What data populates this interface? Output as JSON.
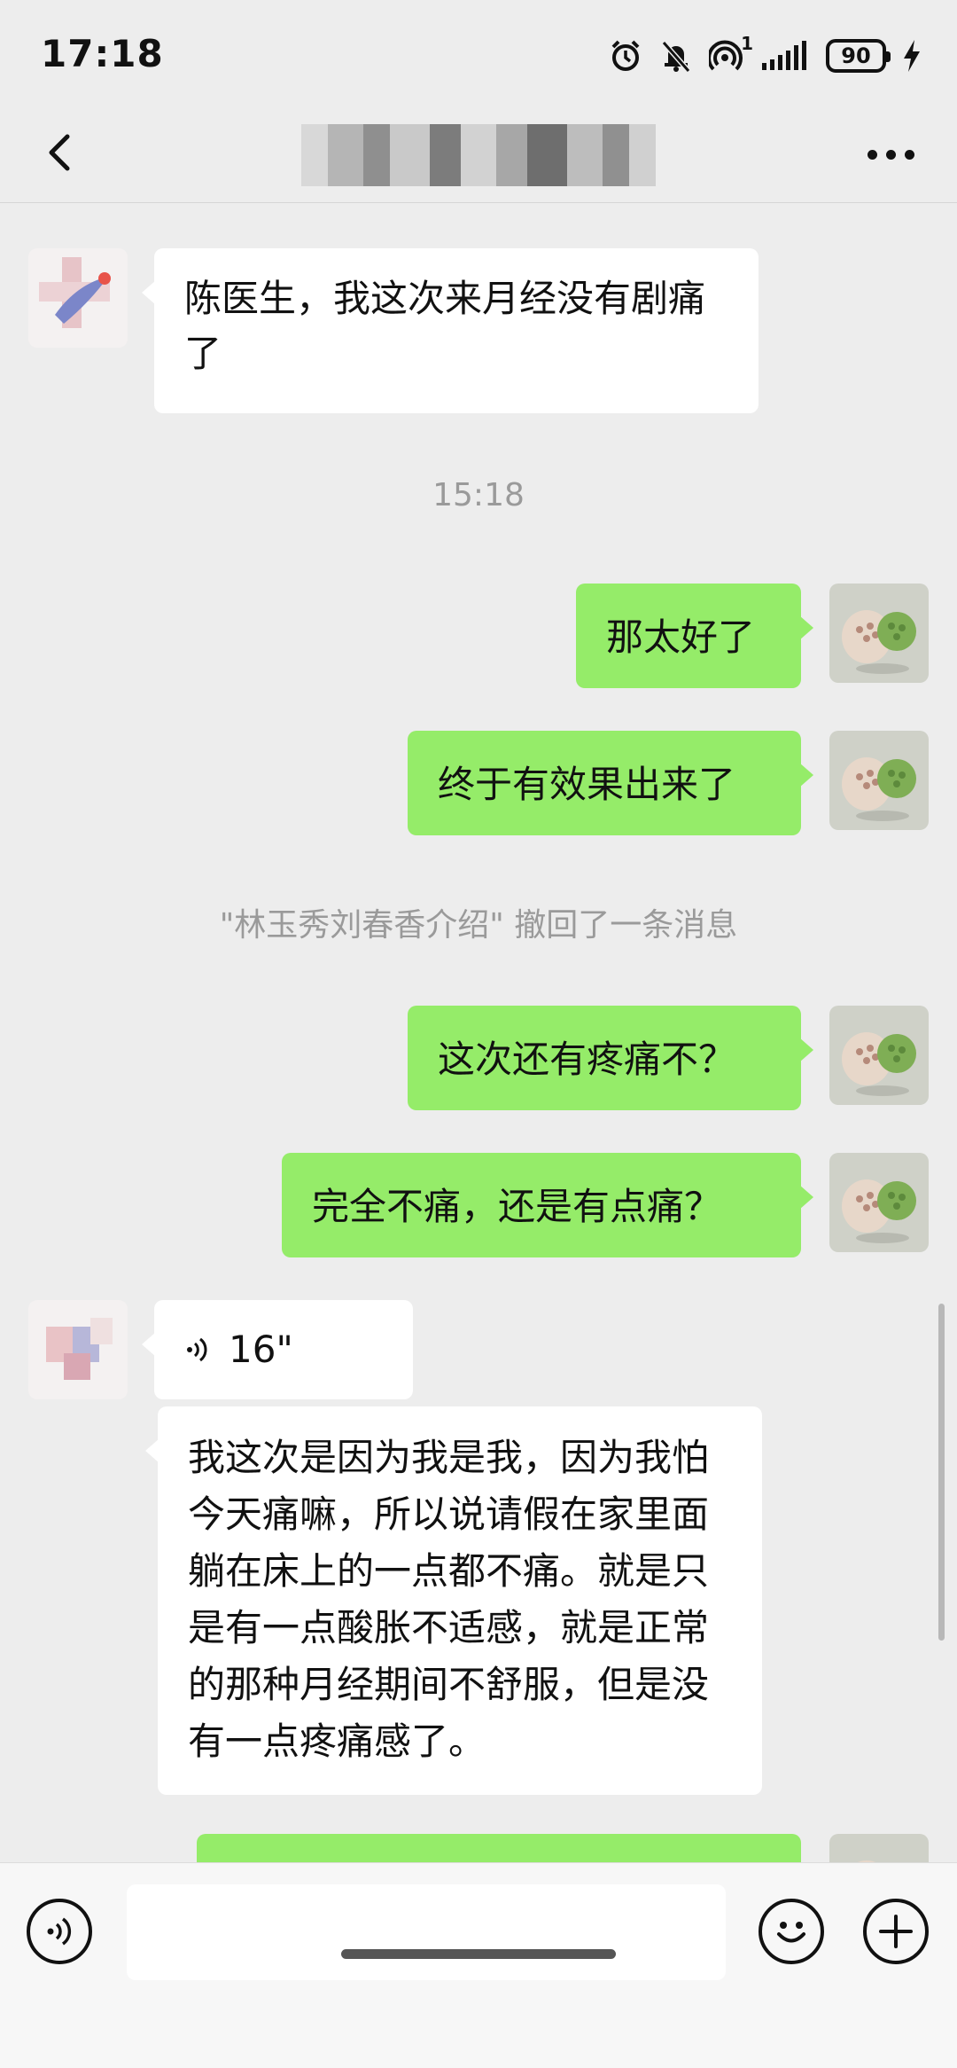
{
  "status_bar": {
    "time": "17:18",
    "battery": "90",
    "signal_super": "1"
  },
  "header": {
    "back_icon": "chevron-left-icon",
    "more_icon": "more-dots-icon"
  },
  "messages": {
    "m1": "陈医生，我这次来月经没有剧痛了",
    "timestamp": "15:18",
    "m2": "那太好了",
    "m3": "终于有效果出来了",
    "recall_notice": "\"林玉秀刘春香介绍\" 撤回了一条消息",
    "m4": "这次还有疼痛不？",
    "m5": "完全不痛，还是有点痛？",
    "voice_duration": "16\"",
    "m6": "我这次是因为我是我，因为我怕今天痛嘛，所以说请假在家里面躺在床上的一点都不痛。就是只是有一点酸胀不适感，就是正常的那种月经期间不舒服，但是没有一点疼痛感了。"
  },
  "input_bar": {
    "voice_icon": "voice-mode-icon",
    "emoji_icon": "emoji-icon",
    "plus_icon": "plus-icon"
  },
  "colors": {
    "background": "#ededed",
    "outgoing_bubble": "#95ec69",
    "incoming_bubble": "#ffffff",
    "system_text": "#9a9a9a"
  }
}
